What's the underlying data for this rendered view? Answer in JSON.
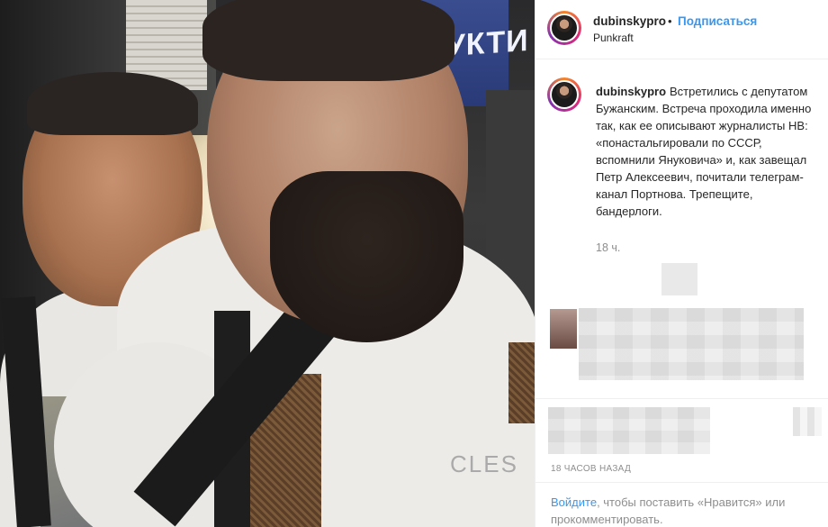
{
  "photo": {
    "sign_text": "ДУКТИ",
    "shirt_text": "CLES"
  },
  "header": {
    "username": "dubinskypro",
    "separator": "•",
    "follow_label": "Подписаться",
    "location": "Punkraft"
  },
  "caption": {
    "username": "dubinskypro",
    "text": "Встретились с депутатом Бужанским. Встреча проходила именно так, как ее описывают журналисты НВ: «понастальгировали по СССР, вспомнили Януковича» и, как завещал Петр Алексеевич, почитали телеграм-канал Портнова. Трепещите, бандерлоги.",
    "time": "18 ч."
  },
  "time_ago": "18 часов назад",
  "login": {
    "link_label": "Войдите",
    "rest_text": ", чтобы поставить «Нравится» или прокомментировать."
  },
  "colors": {
    "link": "#3897f0",
    "muted": "#8e8e8e",
    "text": "#262626",
    "border": "#efefef"
  }
}
